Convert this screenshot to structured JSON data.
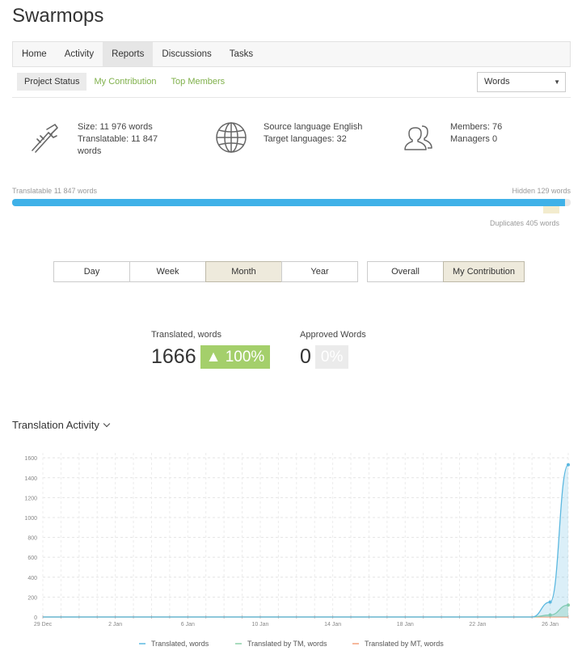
{
  "app": {
    "title": "Swarmops"
  },
  "main_nav": [
    {
      "label": "Home",
      "active": false
    },
    {
      "label": "Activity",
      "active": false
    },
    {
      "label": "Reports",
      "active": true
    },
    {
      "label": "Discussions",
      "active": false
    },
    {
      "label": "Tasks",
      "active": false
    }
  ],
  "sub_nav": [
    {
      "label": "Project Status",
      "active": true
    },
    {
      "label": "My Contribution",
      "active": false
    },
    {
      "label": "Top Members",
      "active": false
    }
  ],
  "unit_select": {
    "value": "Words"
  },
  "stats": {
    "size": "Size: 11 976 words",
    "translatable_line1": "Translatable: 11 847",
    "translatable_line2": "words",
    "source_language": "Source language English",
    "target_languages": "Target languages: 32",
    "members": "Members: 76",
    "managers": "Managers 0"
  },
  "progress": {
    "translatable_label": "Translatable 11 847 words",
    "hidden_label": "Hidden 129 words",
    "duplicates_label": "Duplicates 405 words",
    "translatable_fraction": 0.9892,
    "duplicates_fraction": 0.0338
  },
  "period_buttons": [
    {
      "label": "Day",
      "active": false
    },
    {
      "label": "Week",
      "active": false
    },
    {
      "label": "Month",
      "active": true
    },
    {
      "label": "Year",
      "active": false
    }
  ],
  "scope_buttons": [
    {
      "label": "Overall",
      "active": false
    },
    {
      "label": "My Contribution",
      "active": true
    }
  ],
  "metrics": {
    "translated": {
      "label": "Translated, words",
      "value": "1666",
      "badge": "▲ 100%"
    },
    "approved": {
      "label": "Approved Words",
      "value": "0",
      "badge": "0%"
    }
  },
  "activity": {
    "title": "Translation Activity"
  },
  "colors": {
    "accent_green": "#7fb04a",
    "progress_blue": "#3fb1e8",
    "series_translated": "#5bb8e0",
    "series_tm": "#8cd0a8",
    "series_mt": "#f2a07b"
  },
  "chart_data": {
    "type": "area",
    "x_ticks": [
      "29 Dec",
      "2 Jan",
      "6 Jan",
      "10 Jan",
      "14 Jan",
      "18 Jan",
      "22 Jan",
      "26 Jan"
    ],
    "y_ticks": [
      0,
      200,
      400,
      600,
      800,
      1000,
      1200,
      1400,
      1600
    ],
    "ylim": [
      0,
      1650
    ],
    "x_start": "2023-12-29",
    "x_end": "2024-01-27",
    "grid": true,
    "legend_position": "bottom",
    "series": [
      {
        "name": "Translated, words",
        "color": "#5bb8e0",
        "points": [
          [
            "2023-12-29",
            0
          ],
          [
            "2024-01-24",
            0
          ],
          [
            "2024-01-25",
            0
          ],
          [
            "2024-01-26",
            150
          ],
          [
            "2024-01-27",
            1530
          ]
        ]
      },
      {
        "name": "Translated by TM, words",
        "color": "#8cd0a8",
        "points": [
          [
            "2023-12-29",
            0
          ],
          [
            "2024-01-25",
            0
          ],
          [
            "2024-01-26",
            20
          ],
          [
            "2024-01-27",
            120
          ]
        ]
      },
      {
        "name": "Translated by MT, words",
        "color": "#f2a07b",
        "points": [
          [
            "2023-12-29",
            0
          ],
          [
            "2024-01-27",
            0
          ]
        ]
      }
    ]
  }
}
